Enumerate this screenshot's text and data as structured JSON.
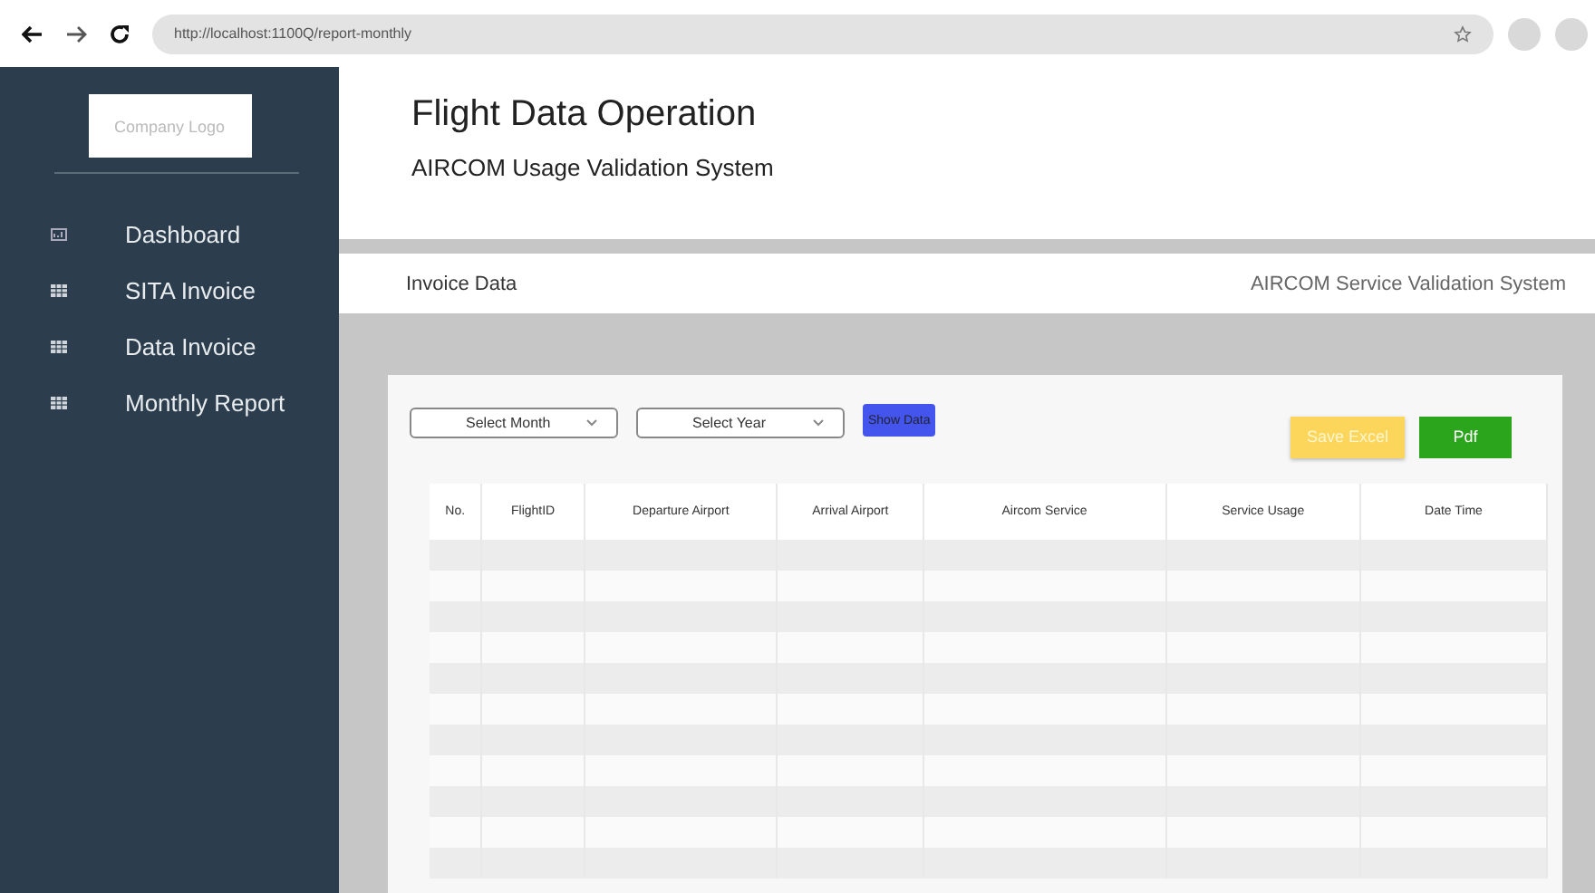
{
  "browser": {
    "url": "http://localhost:1100Q/report-monthly"
  },
  "sidebar": {
    "logo": "Company Logo",
    "items": [
      {
        "label": "Dashboard",
        "kind": "dashboard"
      },
      {
        "label": "SITA Invoice",
        "kind": "table"
      },
      {
        "label": "Data Invoice",
        "kind": "table"
      },
      {
        "label": "Monthly Report",
        "kind": "table"
      }
    ]
  },
  "header": {
    "title": "Flight Data Operation",
    "subtitle": "AIRCOM Usage Validation System"
  },
  "section_bar": {
    "title": "Invoice Data",
    "system": "AIRCOM Service Validation System"
  },
  "filters": {
    "month": {
      "placeholder": "Select Month"
    },
    "year": {
      "placeholder": "Select Year"
    },
    "show_button": "Show Data"
  },
  "actions": [
    {
      "label": "Save Excel",
      "kind": "excel"
    },
    {
      "label": "Pdf",
      "kind": "pdf"
    }
  ],
  "table": {
    "columns": [
      "No.",
      "FlightID",
      "Departure Airport",
      "Arrival Airport",
      "Aircom Service",
      "Service Usage",
      "Date Time"
    ]
  }
}
